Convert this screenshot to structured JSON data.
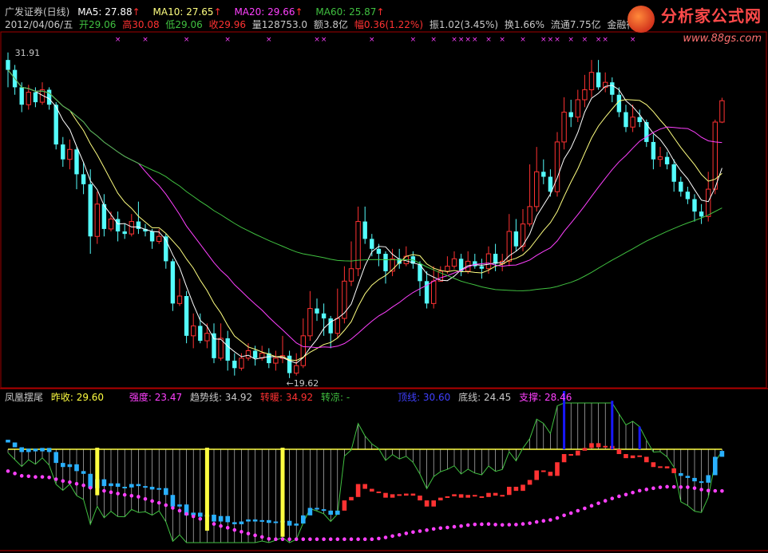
{
  "header": {
    "title": "广发证券(日线)",
    "ma5": "MA5: 27.88",
    "ma10": "MA10: 27.65",
    "ma20": "MA20: 29.66",
    "ma60": "MA60: 25.87",
    "date": "2012/04/06/五",
    "open": "开29.06",
    "high": "高30.08",
    "low": "低29.06",
    "close": "收29.96",
    "volume": "量128753.0",
    "amount": "额3.8亿",
    "change": "幅0.36(1.22%)",
    "amplitude": "振1.02(3.45%)",
    "turnover": "换1.66%",
    "float": "流通7.75亿",
    "industry": "金融行业",
    "up_arrow": "↑"
  },
  "logo": {
    "name": "分析家公式网",
    "url": "www.88gs.com"
  },
  "indicator": {
    "name": "凤凰摆尾",
    "prev_close": "昨收: 29.60",
    "strength": "强度: 23.47",
    "trend": "趋势线: 34.92",
    "turn_warm": "转暖: 34.92",
    "turn_cool": "转凉: -",
    "top_line": "顶线: 30.60",
    "bottom_line": "底线: 24.45",
    "support": "支撑: 28.46"
  },
  "colors": {
    "up": "#ff3232",
    "down": "#54fcfc",
    "ma5": "#ffffff",
    "ma10": "#ffff80",
    "ma20": "#ff40ff",
    "ma60": "#40c040",
    "yellow": "#ffff40",
    "magenta": "#ff40ff",
    "cyan": "#2ab0ff",
    "blue": "#1818ff"
  },
  "chart_data": [
    {
      "type": "candlestick",
      "annotations": [
        {
          "label": "31.91"
        },
        {
          "label": "←19.62"
        }
      ],
      "ylim": [
        18.6,
        32.6
      ],
      "candles": [
        [
          31.6,
          31.2,
          31.9,
          30.5
        ],
        [
          31.2,
          30.5,
          31.4,
          30.2
        ],
        [
          30.5,
          29.8,
          30.7,
          29.5
        ],
        [
          29.8,
          30.3,
          30.6,
          29.6
        ],
        [
          30.3,
          29.9,
          30.5,
          29.7
        ],
        [
          29.9,
          30.4,
          30.7,
          29.8
        ],
        [
          30.4,
          29.8,
          30.5,
          29.6
        ],
        [
          29.8,
          28.2,
          29.9,
          28.0
        ],
        [
          28.2,
          27.6,
          28.5,
          27.3
        ],
        [
          27.6,
          28.0,
          28.4,
          27.2
        ],
        [
          28.0,
          27.0,
          28.1,
          26.4
        ],
        [
          27.0,
          26.6,
          27.5,
          26.2
        ],
        [
          26.6,
          24.5,
          27.2,
          23.8
        ],
        [
          24.5,
          25.8,
          26.3,
          24.2
        ],
        [
          25.8,
          24.8,
          26.2,
          24.5
        ],
        [
          24.8,
          25.2,
          25.5,
          24.7
        ],
        [
          25.2,
          24.7,
          25.5,
          24.3
        ],
        [
          24.7,
          24.6,
          25.0,
          24.4
        ],
        [
          24.6,
          25.1,
          25.4,
          24.5
        ],
        [
          25.1,
          24.8,
          25.9,
          24.6
        ],
        [
          24.8,
          24.7,
          25.0,
          24.5
        ],
        [
          24.7,
          24.3,
          24.8,
          24.0
        ],
        [
          24.3,
          24.5,
          24.8,
          24.2
        ],
        [
          24.5,
          23.5,
          24.6,
          23.2
        ],
        [
          23.5,
          21.8,
          23.6,
          21.5
        ],
        [
          21.8,
          22.1,
          22.8,
          21.7
        ],
        [
          22.1,
          20.5,
          22.3,
          20.2
        ],
        [
          20.5,
          20.9,
          21.4,
          20.0
        ],
        [
          20.9,
          20.3,
          21.4,
          20.2
        ],
        [
          20.3,
          20.6,
          21.0,
          20.0
        ],
        [
          20.6,
          19.6,
          21.0,
          19.4
        ],
        [
          19.6,
          20.4,
          21.0,
          19.5
        ],
        [
          20.4,
          19.5,
          20.7,
          19.1
        ],
        [
          19.5,
          19.2,
          19.8,
          18.9
        ],
        [
          19.2,
          19.6,
          19.8,
          19.1
        ],
        [
          19.6,
          19.9,
          20.2,
          19.5
        ],
        [
          19.9,
          19.6,
          20.1,
          19.3
        ],
        [
          19.6,
          19.8,
          20.1,
          19.5
        ],
        [
          19.8,
          19.4,
          20.0,
          19.2
        ],
        [
          19.4,
          19.6,
          19.9,
          19.1
        ],
        [
          19.6,
          19.7,
          20.5,
          19.4
        ],
        [
          19.7,
          19.0,
          19.9,
          18.8
        ],
        [
          19.0,
          19.3,
          19.8,
          18.9
        ],
        [
          19.3,
          20.5,
          21.2,
          19.2
        ],
        [
          20.5,
          21.6,
          22.3,
          20.3
        ],
        [
          21.6,
          21.4,
          22.0,
          21.1
        ],
        [
          21.4,
          21.2,
          21.8,
          20.5
        ],
        [
          21.2,
          20.6,
          21.3,
          20.0
        ],
        [
          20.6,
          21.2,
          22.4,
          20.4
        ],
        [
          21.2,
          22.7,
          23.3,
          21.0
        ],
        [
          22.7,
          23.2,
          24.3,
          22.5
        ],
        [
          23.2,
          25.1,
          25.7,
          22.9
        ],
        [
          25.1,
          24.4,
          25.7,
          24.2
        ],
        [
          24.4,
          24.0,
          24.6,
          23.7
        ],
        [
          24.0,
          23.8,
          24.2,
          23.3
        ],
        [
          23.8,
          23.1,
          23.9,
          22.6
        ],
        [
          23.1,
          23.6,
          24.0,
          22.9
        ],
        [
          23.6,
          23.4,
          24.0,
          23.2
        ],
        [
          23.4,
          23.7,
          24.1,
          23.3
        ],
        [
          23.7,
          23.4,
          23.9,
          23.2
        ],
        [
          23.4,
          22.7,
          23.5,
          22.1
        ],
        [
          22.7,
          21.8,
          23.1,
          21.6
        ],
        [
          21.8,
          22.7,
          23.3,
          21.6
        ],
        [
          22.7,
          23.1,
          23.3,
          22.8
        ],
        [
          23.1,
          23.3,
          23.7,
          23.0
        ],
        [
          23.3,
          23.6,
          23.9,
          23.2
        ],
        [
          23.6,
          23.1,
          23.8,
          22.9
        ],
        [
          23.1,
          23.5,
          23.9,
          23.0
        ],
        [
          23.5,
          23.3,
          23.8,
          23.2
        ],
        [
          23.3,
          23.2,
          23.6,
          22.8
        ],
        [
          23.2,
          23.8,
          24.1,
          23.0
        ],
        [
          23.8,
          23.4,
          24.2,
          23.1
        ],
        [
          23.4,
          23.5,
          23.8,
          23.1
        ],
        [
          23.5,
          24.7,
          25.4,
          23.3
        ],
        [
          24.7,
          24.1,
          25.2,
          23.9
        ],
        [
          24.1,
          25.0,
          25.6,
          23.9
        ],
        [
          25.0,
          25.7,
          27.4,
          24.9
        ],
        [
          25.7,
          27.1,
          28.1,
          25.5
        ],
        [
          27.1,
          26.9,
          27.6,
          26.6
        ],
        [
          26.9,
          26.3,
          27.2,
          26.1
        ],
        [
          26.3,
          28.3,
          28.7,
          26.1
        ],
        [
          28.3,
          29.5,
          30.1,
          28.0
        ],
        [
          29.5,
          29.3,
          30.0,
          28.9
        ],
        [
          29.3,
          30.0,
          30.4,
          29.1
        ],
        [
          30.0,
          30.4,
          31.0,
          29.7
        ],
        [
          30.4,
          31.1,
          31.6,
          30.1
        ],
        [
          31.1,
          30.5,
          31.6,
          30.4
        ],
        [
          30.5,
          30.7,
          31.1,
          30.3
        ],
        [
          30.7,
          30.2,
          30.9,
          29.9
        ],
        [
          30.2,
          29.5,
          30.5,
          29.3
        ],
        [
          29.5,
          28.9,
          29.8,
          28.7
        ],
        [
          28.9,
          29.3,
          29.8,
          28.7
        ],
        [
          29.3,
          29.1,
          29.6,
          28.9
        ],
        [
          29.1,
          28.3,
          29.2,
          28.1
        ],
        [
          28.3,
          27.6,
          28.6,
          27.2
        ],
        [
          27.6,
          27.7,
          28.1,
          27.3
        ],
        [
          27.7,
          27.4,
          27.9,
          27.2
        ],
        [
          27.4,
          26.7,
          27.6,
          26.3
        ],
        [
          26.7,
          26.3,
          26.9,
          26.1
        ],
        [
          26.3,
          26.0,
          26.5,
          25.8
        ],
        [
          26.0,
          25.5,
          26.2,
          25.1
        ],
        [
          25.5,
          25.3,
          25.8,
          25.0
        ],
        [
          25.3,
          26.4,
          27.1,
          25.1
        ],
        [
          26.4,
          29.1,
          29.2,
          26.2
        ],
        [
          29.1,
          29.96,
          30.08,
          29.06
        ]
      ]
    },
    {
      "type": "indicator",
      "ylim": [
        16.5,
        37.0
      ],
      "bullish_days": [
        49,
        50,
        51,
        52,
        53,
        54,
        55,
        56,
        57,
        58,
        59,
        60,
        61,
        62,
        63,
        64,
        65,
        66,
        67,
        68,
        69,
        70,
        71,
        72,
        73,
        74,
        75,
        76,
        77,
        78,
        79,
        80,
        81,
        82,
        83,
        84,
        85,
        86,
        87,
        88,
        89,
        90,
        91,
        92,
        93,
        94,
        95,
        96,
        97
      ],
      "extreme_days": [
        13,
        29,
        40
      ],
      "blue_days": [
        81,
        88,
        92
      ]
    }
  ]
}
